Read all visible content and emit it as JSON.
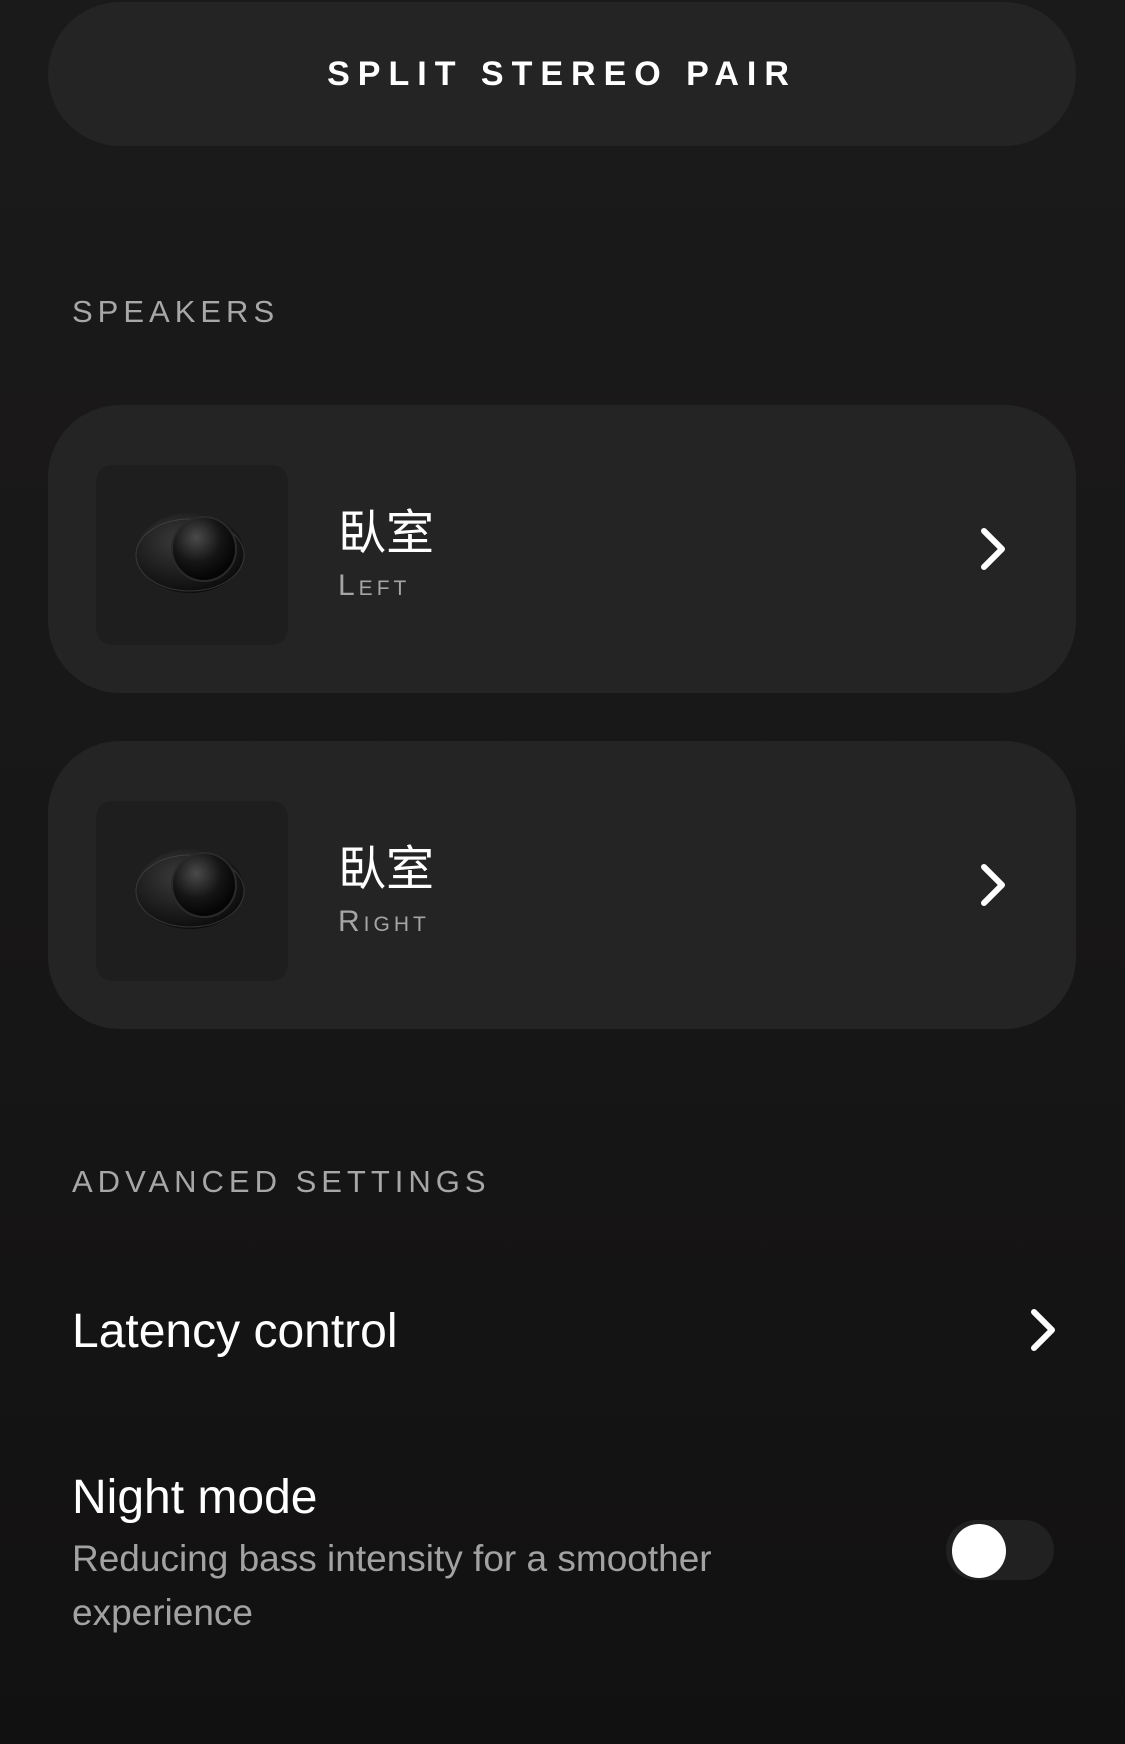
{
  "split_button": {
    "label": "SPLIT STEREO PAIR"
  },
  "speakers_section": {
    "title": "SPEAKERS",
    "items": [
      {
        "name": "臥室",
        "role": "Left",
        "icon": "speaker-icon"
      },
      {
        "name": "臥室",
        "role": "Right",
        "icon": "speaker-icon"
      }
    ]
  },
  "advanced_section": {
    "title": "ADVANCED SETTINGS",
    "latency": {
      "label": "Latency control",
      "icon": "chevron-right-icon"
    },
    "night_mode": {
      "label": "Night mode",
      "description": "Reducing bass intensity for a smoother experience",
      "enabled": false
    }
  },
  "colors": {
    "background": "#181717",
    "card": "#252424",
    "text_primary": "#ffffff",
    "text_secondary": "#a6a5a5"
  }
}
